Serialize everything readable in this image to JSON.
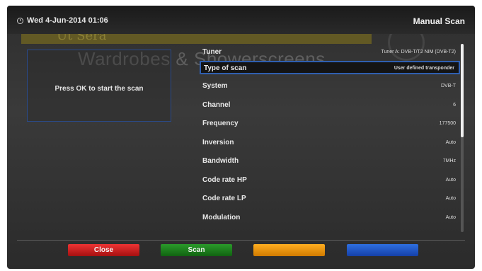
{
  "header": {
    "datetime": "Wed  4-Jun-2014 01:06",
    "title": "Manual Scan"
  },
  "background": {
    "logo_text": "Ut Sera",
    "banner_text": "Wardrobes & Showerscreens"
  },
  "info": {
    "message": "Press OK to start the scan"
  },
  "menu": {
    "rows": [
      {
        "label": "Tuner",
        "value": "Tuner A: DVB-T/T2 NIM (DVB-T2)"
      },
      {
        "label": "Type of scan",
        "value": "User defined transponder"
      },
      {
        "label": "System",
        "value": "DVB-T"
      },
      {
        "label": "Channel",
        "value": "6"
      },
      {
        "label": "Frequency",
        "value": "177500"
      },
      {
        "label": "Inversion",
        "value": "Auto"
      },
      {
        "label": "Bandwidth",
        "value": "7MHz"
      },
      {
        "label": "Code rate HP",
        "value": "Auto"
      },
      {
        "label": "Code rate LP",
        "value": "Auto"
      },
      {
        "label": "Modulation",
        "value": "Auto"
      }
    ],
    "selected_index": 1
  },
  "buttons": {
    "red": "Close",
    "green": "Scan",
    "yellow": "",
    "blue": ""
  },
  "colors": {
    "accent": "#2f5fb0",
    "red": "#c81e1e",
    "green": "#1e7f1e",
    "yellow": "#f0960a",
    "blue": "#1f55c8"
  }
}
